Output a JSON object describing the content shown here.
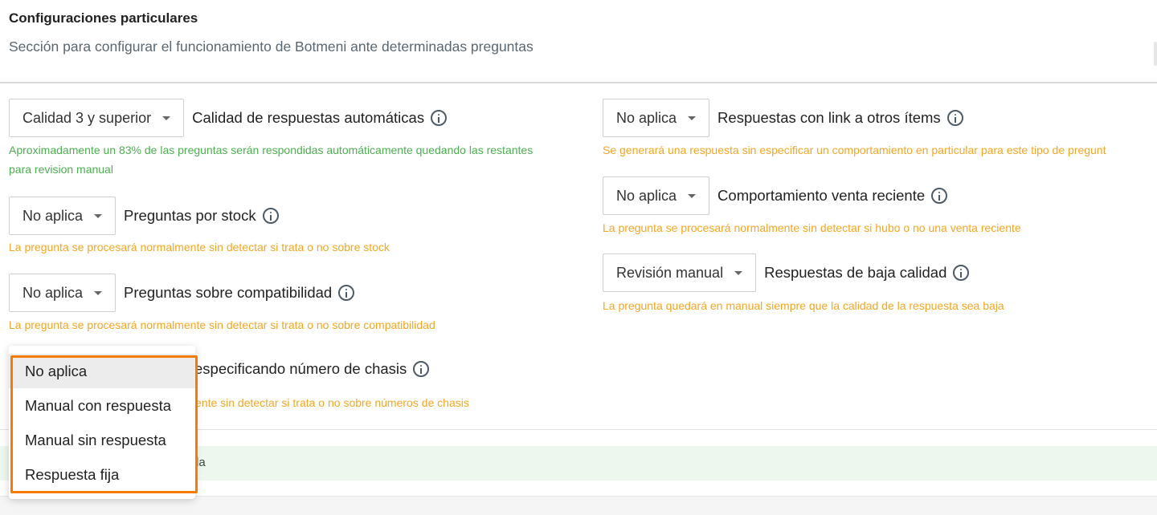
{
  "header": {
    "title": "Configuraciones particulares",
    "subtitle": "Sección para configurar el funcionamiento de Botmeni ante determinadas preguntas"
  },
  "left": {
    "quality": {
      "value": "Calidad 3 y superior",
      "label": "Calidad de respuestas automáticas",
      "hint_line1": "Aproximadamente un 83% de las preguntas serán respondidas automáticamente quedando las restantes",
      "hint_line2": "para revision manual"
    },
    "stock": {
      "value": "No aplica",
      "label": "Preguntas por stock",
      "hint": "La pregunta se procesará normalmente sin detectar si trata o no sobre stock"
    },
    "compat": {
      "value": "No aplica",
      "label": "Preguntas sobre compatibilidad",
      "hint": "La pregunta se procesará normalmente sin detectar si trata o no sobre compatibilidad"
    },
    "chasis": {
      "label_partial": "especificando número de chasis",
      "hint_partial": "ente sin detectar si trata o no sobre números de chasis"
    }
  },
  "right": {
    "links": {
      "value": "No aplica",
      "label": "Respuestas con link a otros ítems",
      "hint": "Se generará una respuesta sin especificar un comportamiento en particular para este tipo de pregunt"
    },
    "recent": {
      "value": "No aplica",
      "label": "Comportamiento venta reciente",
      "hint": "La pregunta se procesará normalmente sin detectar si hubo o no una venta reciente"
    },
    "lowquality": {
      "value": "Revisión manual",
      "label": "Respuestas de baja calidad",
      "hint": "La pregunta quedará en manual siempre que la calidad de la respuesta sea baja"
    }
  },
  "banner": {
    "text_partial": "la"
  },
  "dropdown": {
    "options": [
      "No aplica",
      "Manual con respuesta",
      "Manual sin respuesta",
      "Respuesta fija"
    ],
    "selected_index": 0,
    "highlight_color": "#f57c00"
  },
  "colors": {
    "hint_green": "#4caf50",
    "hint_orange": "#f5a623",
    "banner_bg": "#eef7ee"
  },
  "icons": [
    "info-icon",
    "chevron-down-icon"
  ]
}
